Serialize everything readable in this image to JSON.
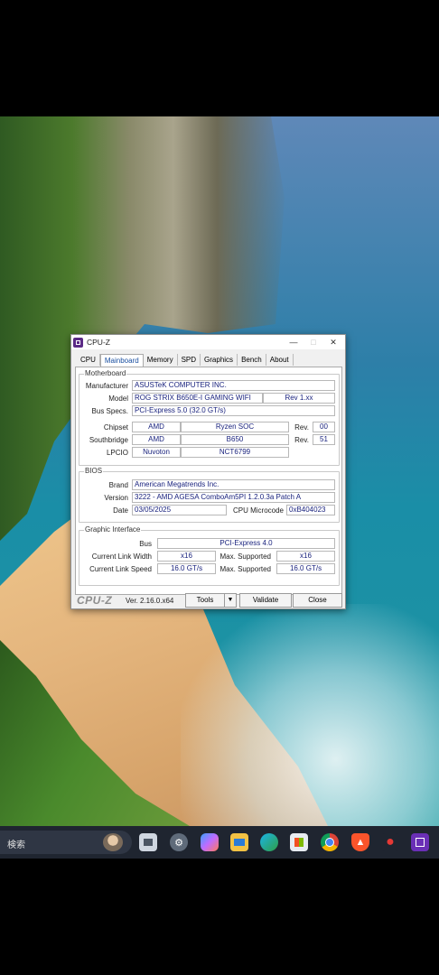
{
  "window": {
    "title": "CPU-Z",
    "tabs": [
      "CPU",
      "Mainboard",
      "Memory",
      "SPD",
      "Graphics",
      "Bench",
      "About"
    ],
    "active_tab": "Mainboard"
  },
  "motherboard": {
    "group_title": "Motherboard",
    "manufacturer_label": "Manufacturer",
    "manufacturer": "ASUSTeK COMPUTER INC.",
    "model_label": "Model",
    "model": "ROG STRIX B650E-I GAMING WIFI",
    "rev": "Rev 1.xx",
    "bus_specs_label": "Bus Specs.",
    "bus_specs": "PCI-Express 5.0 (32.0 GT/s)",
    "chipset_label": "Chipset",
    "chipset_vendor": "AMD",
    "chipset_model": "Ryzen SOC",
    "chipset_rev_label": "Rev.",
    "chipset_rev": "00",
    "southbridge_label": "Southbridge",
    "southbridge_vendor": "AMD",
    "southbridge_model": "B650",
    "southbridge_rev_label": "Rev.",
    "southbridge_rev": "51",
    "lpcio_label": "LPCIO",
    "lpcio_vendor": "Nuvoton",
    "lpcio_model": "NCT6799"
  },
  "bios": {
    "group_title": "BIOS",
    "brand_label": "Brand",
    "brand": "American Megatrends Inc.",
    "version_label": "Version",
    "version": "3222 - AMD AGESA ComboAm5PI 1.2.0.3a Patch A",
    "date_label": "Date",
    "date": "03/05/2025",
    "microcode_label": "CPU Microcode",
    "microcode": "0xB404023"
  },
  "graphic": {
    "group_title": "Graphic Interface",
    "bus_label": "Bus",
    "bus": "PCI-Express 4.0",
    "link_width_label": "Current Link Width",
    "link_width": "x16",
    "max_width_label": "Max. Supported",
    "max_width": "x16",
    "link_speed_label": "Current Link Speed",
    "link_speed": "16.0 GT/s",
    "max_speed_label": "Max. Supported",
    "max_speed": "16.0 GT/s"
  },
  "footer": {
    "brand": "CPU-Z",
    "version": "Ver. 2.16.0.x64",
    "tools_label": "Tools",
    "validate_label": "Validate",
    "close_label": "Close"
  },
  "taskbar": {
    "search_text": "検索",
    "icons": [
      "task-view-icon",
      "settings-icon",
      "copilot-icon",
      "file-explorer-icon",
      "edge-icon",
      "store-icon",
      "chrome-icon",
      "brave-icon",
      "recorder-icon",
      "cpu-z-icon"
    ]
  }
}
